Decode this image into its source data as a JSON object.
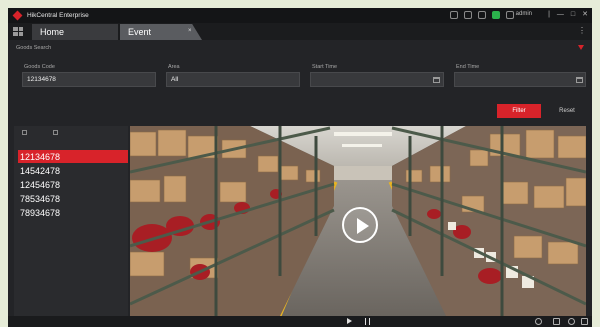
{
  "app": {
    "title": "HikCentral Enterprise",
    "user": "admin"
  },
  "window_controls": [
    "|",
    "—",
    "□",
    "✕"
  ],
  "tabs": [
    {
      "label": "Home"
    },
    {
      "label": "Event"
    }
  ],
  "tab_close": "×",
  "tab_more": "⋮",
  "section": {
    "label": "Goods Search"
  },
  "filters": {
    "goods_code": {
      "label": "Goods Code",
      "value": "12134678"
    },
    "area": {
      "label": "Area",
      "value": "All"
    },
    "start_time": {
      "label": "Start Time",
      "value": ""
    },
    "end_time": {
      "label": "End Time",
      "value": ""
    }
  },
  "buttons": {
    "filter": "Filter",
    "reset": "Reset"
  },
  "results": [
    "12134678",
    "14542478",
    "12454678",
    "78534678",
    "78934678"
  ],
  "icons": {
    "logo": "hikvision-logo-icon",
    "home_grid": "grid-icon",
    "filter": "filter-funnel-icon",
    "calendar": "calendar-icon",
    "play": "play-icon",
    "pause": "pause-icon"
  },
  "colors": {
    "accent": "#d8232a",
    "background": "#232427",
    "status_online": "#2bb24c"
  }
}
